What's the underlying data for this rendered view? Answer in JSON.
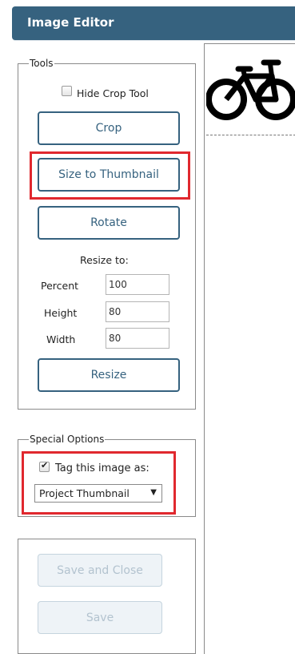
{
  "window": {
    "title": "Image Editor"
  },
  "tools": {
    "legend": "Tools",
    "hide_crop_label": "Hide Crop Tool",
    "hide_crop_checked": false,
    "crop_label": "Crop",
    "size_to_thumbnail_label": "Size to Thumbnail",
    "rotate_label": "Rotate",
    "resize_to_label": "Resize to:",
    "percent_label": "Percent",
    "percent_value": "100",
    "height_label": "Height",
    "height_value": "80",
    "width_label": "Width",
    "width_value": "80",
    "resize_label": "Resize"
  },
  "special": {
    "legend": "Special Options",
    "tag_label": "Tag this image as:",
    "tag_checked": true,
    "tag_value": "Project Thumbnail"
  },
  "actions": {
    "save_close_label": "Save and Close",
    "save_label": "Save"
  },
  "preview": {
    "image_icon": "bicycle-icon"
  },
  "colors": {
    "header": "#36627f",
    "highlight": "#e0282e"
  }
}
